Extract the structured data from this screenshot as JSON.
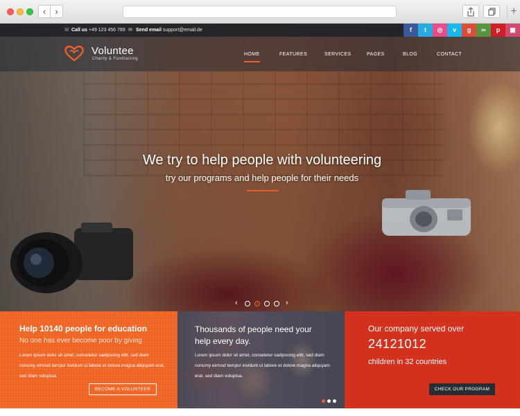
{
  "topbar": {
    "call_label": "Call us",
    "phone": "+49 123 456 789",
    "email_label": "Send email",
    "email": "support@email.de",
    "social": [
      {
        "icon": "facebook-icon",
        "glyph": "f",
        "color": "#3b5998"
      },
      {
        "icon": "twitter-icon",
        "glyph": "t",
        "color": "#28aae1"
      },
      {
        "icon": "dribbble-icon",
        "glyph": "◎",
        "color": "#e84c88"
      },
      {
        "icon": "vimeo-icon",
        "glyph": "v",
        "color": "#1ab7ea"
      },
      {
        "icon": "googleplus-icon",
        "glyph": "g",
        "color": "#dd4b39"
      },
      {
        "icon": "tripadvisor-icon",
        "glyph": "∞",
        "color": "#589442"
      },
      {
        "icon": "pinterest-icon",
        "glyph": "p",
        "color": "#cb2027"
      },
      {
        "icon": "instagram-icon",
        "glyph": "▣",
        "color": "#d34a70"
      }
    ]
  },
  "brand": {
    "name": "Voluntee",
    "tagline": "Charity & Fundraising",
    "accent": "#e8612c"
  },
  "menu": [
    "HOME",
    "FEATURES",
    "SERVICES",
    "PAGES",
    "BLOG",
    "CONTACT"
  ],
  "hero": {
    "title": "We try to help people with volunteering",
    "subtitle": "try our programs and help people for their needs",
    "prev": "‹",
    "next": "›",
    "slides": 4,
    "active_slide": 2
  },
  "panels": {
    "education": {
      "heading": "Help 10140 people for education",
      "subheading": "No one has ever become poor by giving",
      "body": "Lorem ipsum dolor sit amet, consetetur sadipscing elitr, sed diam nonumy eirmod tempor invidunt ut labore et dolore magna aliquyam erat, sed diam voluptua.",
      "button": "BECOME A VOLUNTEER"
    },
    "help": {
      "heading": "Thousands of people need your help every day.",
      "body": "Lorem ipsum dolor sit amet, consetetur sadipscing elitr, sed diam nonumy eirmod tempor invidunt ut labore et dolore magna aliquyam erat, sed diam voluptua."
    },
    "served": {
      "heading": "Our company served over",
      "number": "24121012",
      "subheading": "children in 32 countries",
      "button": "CHECK OUR PROGRAM"
    }
  }
}
